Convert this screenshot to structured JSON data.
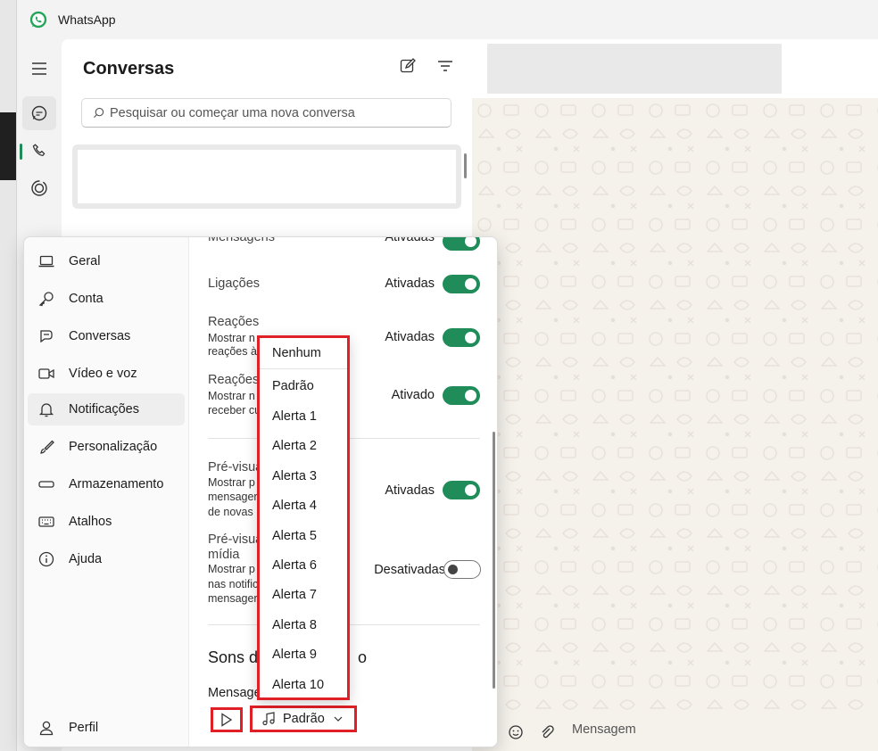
{
  "app": {
    "title": "WhatsApp"
  },
  "rail": {
    "items": [
      "menu-icon",
      "chat-icon",
      "phone-icon",
      "status-icon"
    ]
  },
  "chats": {
    "title": "Conversas",
    "search_placeholder": "Pesquisar ou começar uma nova conversa"
  },
  "settings": {
    "nav": [
      {
        "label": "Geral",
        "icon": "laptop-icon"
      },
      {
        "label": "Conta",
        "icon": "key-icon"
      },
      {
        "label": "Conversas",
        "icon": "chat-icon"
      },
      {
        "label": "Vídeo e voz",
        "icon": "video-icon"
      },
      {
        "label": "Notificações",
        "icon": "bell-icon"
      },
      {
        "label": "Personalização",
        "icon": "brush-icon"
      },
      {
        "label": "Armazenamento",
        "icon": "storage-icon"
      },
      {
        "label": "Atalhos",
        "icon": "keyboard-icon"
      },
      {
        "label": "Ajuda",
        "icon": "info-icon"
      }
    ],
    "profile_label": "Perfil",
    "rows": [
      {
        "title": "Mensagens",
        "status": "Ativadas",
        "on": true
      },
      {
        "title": "Ligações",
        "status": "Ativadas",
        "on": true
      },
      {
        "title": "Reações",
        "desc": [
          "Mostrar n",
          "reações às"
        ],
        "status": "Ativadas",
        "on": true
      },
      {
        "title": "Reações",
        "desc": [
          "Mostrar n",
          "receber cu"
        ],
        "status": "Ativado",
        "on": true
      },
      {
        "title": "Pré-visua",
        "desc": [
          "Mostrar p",
          "mensager",
          "de novas"
        ],
        "status": "Ativadas",
        "on": true
      },
      {
        "title": "Pré-visua",
        "title2": "mídia",
        "desc": [
          "Mostrar p",
          "nas notific",
          "mensager"
        ],
        "status": "Desativadas",
        "on": false
      }
    ],
    "sounds_section_title": "Sons d",
    "sounds_section_tail": "o",
    "sounds_label": "Mensage",
    "sound_selected": "Padrão",
    "dropdown_options": [
      "Nenhum",
      "Padrão",
      "Alerta 1",
      "Alerta 2",
      "Alerta 3",
      "Alerta 4",
      "Alerta 5",
      "Alerta 6",
      "Alerta 7",
      "Alerta 8",
      "Alerta 9",
      "Alerta 10"
    ]
  },
  "composer": {
    "placeholder": "Mensagem"
  },
  "colors": {
    "accent": "#1f8c5a",
    "highlight": "#e01f26"
  }
}
